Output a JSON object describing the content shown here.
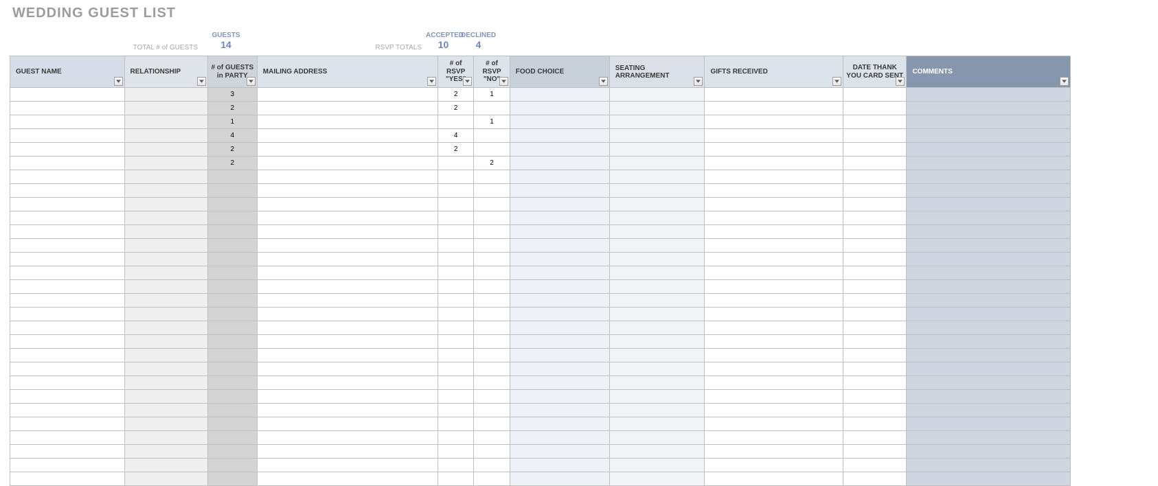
{
  "title": "WEDDING GUEST LIST",
  "summary": {
    "guests_label": "GUESTS",
    "total_guests_label": "TOTAL # of GUESTS",
    "total_guests_value": "14",
    "rsvp_totals_label": "RSVP TOTALS",
    "accepted_label": "ACCEPTED",
    "accepted_value": "10",
    "declined_label": "DECLINED",
    "declined_value": "4"
  },
  "columns": {
    "guest_name": "GUEST NAME",
    "relationship": "RELATIONSHIP",
    "num_guests_party": "# of GUESTS in PARTY",
    "mailing_address": "MAILING ADDRESS",
    "rsvp_yes": "# of RSVP \"YES\"",
    "rsvp_no": "# of RSVP \"NO\"",
    "food_choice": "FOOD CHOICE",
    "seating": "SEATING ARRANGEMENT",
    "gifts": "GIFTS RECEIVED",
    "thankyou": "DATE THANK YOU CARD SENT",
    "comments": "COMMENTS"
  },
  "rows": [
    {
      "num_party": "3",
      "rsvp_yes": "2",
      "rsvp_no": "1"
    },
    {
      "num_party": "2",
      "rsvp_yes": "2",
      "rsvp_no": ""
    },
    {
      "num_party": "1",
      "rsvp_yes": "",
      "rsvp_no": "1"
    },
    {
      "num_party": "4",
      "rsvp_yes": "4",
      "rsvp_no": ""
    },
    {
      "num_party": "2",
      "rsvp_yes": "2",
      "rsvp_no": ""
    },
    {
      "num_party": "2",
      "rsvp_yes": "",
      "rsvp_no": "2"
    },
    {},
    {},
    {},
    {},
    {},
    {},
    {},
    {},
    {},
    {},
    {},
    {},
    {},
    {},
    {},
    {},
    {},
    {},
    {},
    {},
    {},
    {},
    {}
  ]
}
